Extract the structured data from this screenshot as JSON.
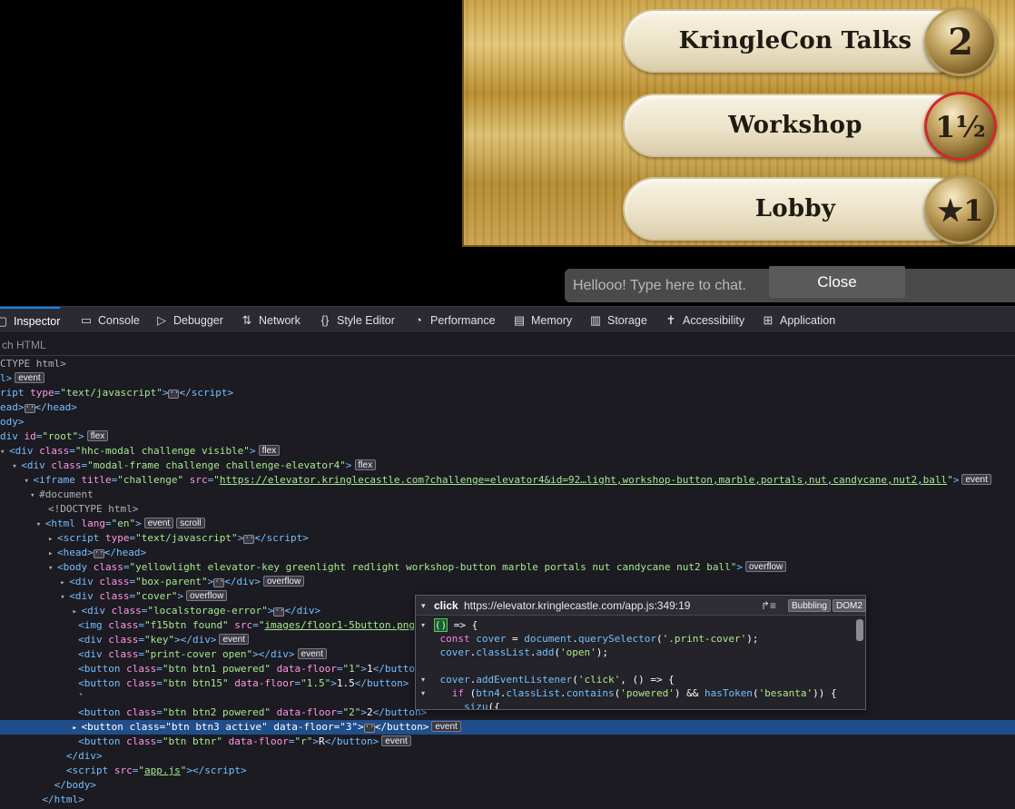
{
  "game": {
    "floors": [
      {
        "label": "KringleCon Talks",
        "knob": "2"
      },
      {
        "label": "Workshop",
        "knob": "1½"
      },
      {
        "label": "Lobby",
        "knob": "★1"
      }
    ],
    "chat_placeholder": "Hellooo! Type here to chat.",
    "close_label": "Close"
  },
  "devtools": {
    "tabs": [
      {
        "label": "Inspector",
        "icon": "inspector-icon"
      },
      {
        "label": "Console",
        "icon": "console-icon"
      },
      {
        "label": "Debugger",
        "icon": "debugger-icon"
      },
      {
        "label": "Network",
        "icon": "network-icon"
      },
      {
        "label": "Style Editor",
        "icon": "style-editor-icon"
      },
      {
        "label": "Performance",
        "icon": "performance-icon"
      },
      {
        "label": "Memory",
        "icon": "memory-icon"
      },
      {
        "label": "Storage",
        "icon": "storage-icon"
      },
      {
        "label": "Accessibility",
        "icon": "accessibility-icon"
      },
      {
        "label": "Application",
        "icon": "application-icon"
      }
    ],
    "search_placeholder": "ch HTML"
  },
  "tooltip": {
    "event": "click",
    "source": "https://elevator.kringlecastle.com/app.js:349:19",
    "badge_bubbling": "Bubbling",
    "badge_dom2": "DOM2"
  },
  "badges": {
    "event": "event",
    "flex": "flex",
    "scroll": "scroll",
    "overflow": "overflow"
  }
}
